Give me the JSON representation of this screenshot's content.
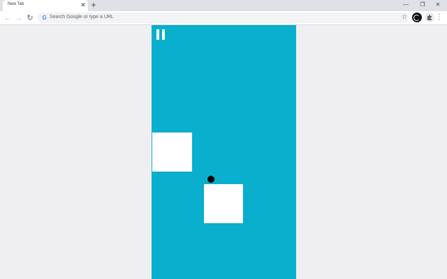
{
  "browser": {
    "tab": {
      "title": "New Tab"
    },
    "omnibox": {
      "placeholder": "Search Google or type a URL"
    },
    "icons": {
      "back": "arrow-left-icon",
      "forward": "arrow-right-icon",
      "reload": "reload-icon",
      "google": "google-icon",
      "bookmark": "star-icon",
      "profile": "avatar-icon",
      "extensions": "puzzle-icon",
      "menu": "kebab-menu-icon",
      "new_tab": "plus-icon",
      "close_tab": "close-icon"
    }
  },
  "game": {
    "background_color": "#09afcd",
    "block_color": "#ffffff",
    "ball_color": "#000000",
    "pause_icon": "pause-icon"
  }
}
